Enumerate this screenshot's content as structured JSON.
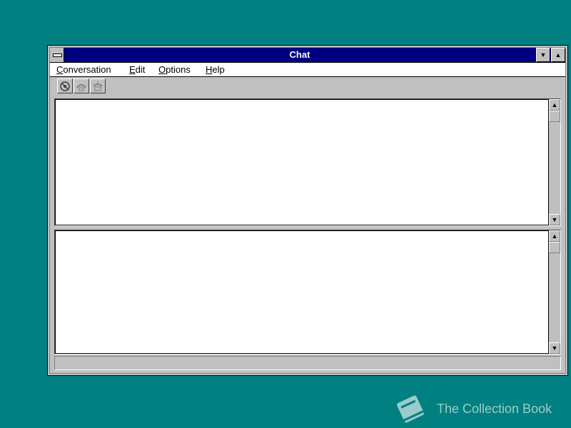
{
  "window": {
    "title": "Chat"
  },
  "menu": {
    "items": [
      {
        "mnemonic": "C",
        "rest": "onversation"
      },
      {
        "mnemonic": "E",
        "rest": "dit"
      },
      {
        "mnemonic": "O",
        "rest": "ptions"
      },
      {
        "mnemonic": "H",
        "rest": "elp"
      }
    ]
  },
  "toolbar": {
    "buttons": [
      {
        "icon": "dial-icon"
      },
      {
        "icon": "answer-icon"
      },
      {
        "icon": "hang-up-icon"
      }
    ]
  },
  "watermark": {
    "text": "The Collection Book"
  },
  "colors": {
    "desktop": "#008080",
    "titlebar": "#000080",
    "face": "#c0c0c0"
  }
}
